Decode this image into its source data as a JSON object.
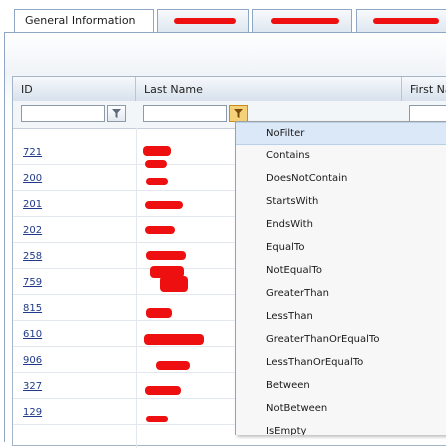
{
  "tabs": [
    {
      "label": "General Information",
      "active": true
    },
    {
      "label": "",
      "redacted": true
    },
    {
      "label": "",
      "redacted": true
    },
    {
      "label": "",
      "redacted": true
    }
  ],
  "grid": {
    "columns": [
      "ID",
      "Last Name",
      "First Na"
    ],
    "rows": [
      {
        "id": "721"
      },
      {
        "id": "200"
      },
      {
        "id": "201"
      },
      {
        "id": "202"
      },
      {
        "id": "258"
      },
      {
        "id": "759"
      },
      {
        "id": "815"
      },
      {
        "id": "610"
      },
      {
        "id": "906"
      },
      {
        "id": "327"
      },
      {
        "id": "129"
      }
    ]
  },
  "filter_menu": {
    "items": [
      "NoFilter",
      "Contains",
      "DoesNotContain",
      "StartsWith",
      "EndsWith",
      "EqualTo",
      "NotEqualTo",
      "GreaterThan",
      "LessThan",
      "GreaterThanOrEqualTo",
      "LessThanOrEqualTo",
      "Between",
      "NotBetween",
      "IsEmpty"
    ],
    "highlighted": "NoFilter"
  },
  "colors": {
    "redaction": "#ee1010",
    "link": "#1f3a8a",
    "menu_highlight": "#dbe8f7"
  }
}
